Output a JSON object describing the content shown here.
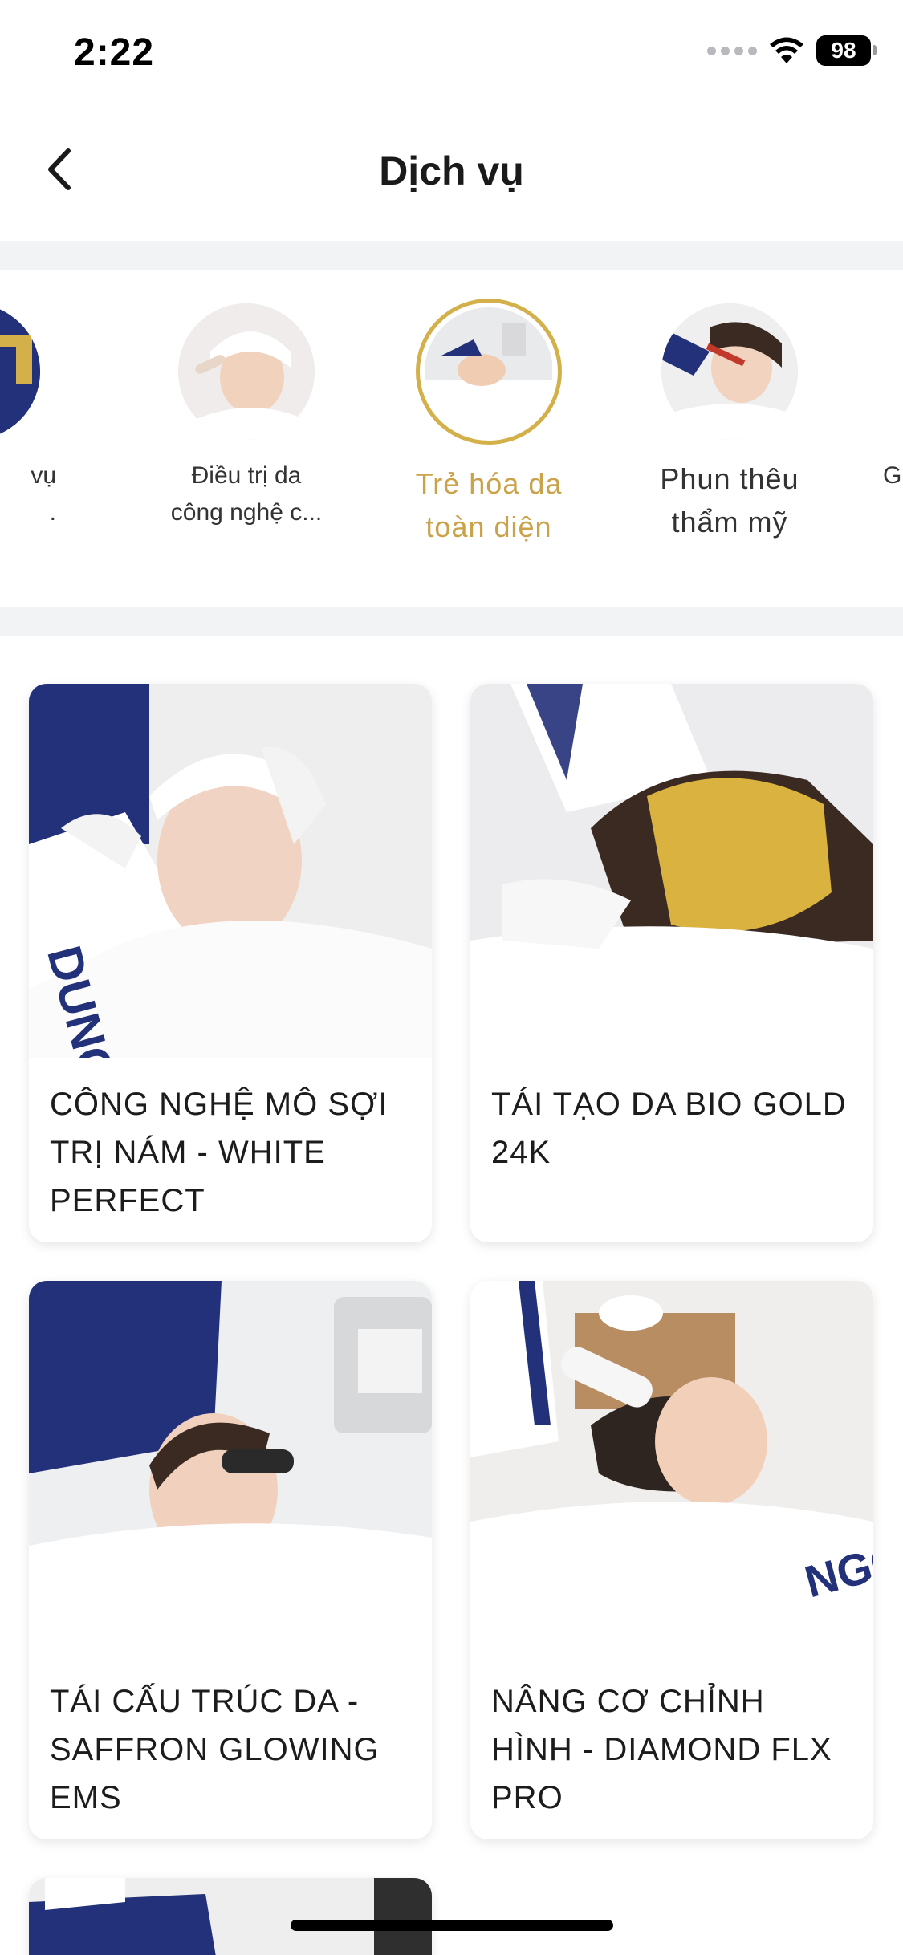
{
  "status": {
    "time": "2:22",
    "battery": "98"
  },
  "header": {
    "title": "Dịch vụ"
  },
  "categories": [
    {
      "label_line1": "vụ",
      "label_line2": "."
    },
    {
      "label_line1": "Điều trị da",
      "label_line2": "công nghệ c..."
    },
    {
      "label_line1": "Trẻ hóa da",
      "label_line2": "toàn diện",
      "active": true
    },
    {
      "label_line1": "Phun thêu",
      "label_line2": "thẩm mỹ"
    },
    {
      "label_line1": "G",
      "label_line2": ""
    }
  ],
  "services": [
    {
      "title": "CÔNG NGHỆ MÔ SỢI TRỊ NÁM - WHITE PERFECT"
    },
    {
      "title": "TÁI TẠO DA BIO GOLD 24K"
    },
    {
      "title": "TÁI CẤU TRÚC DA - SAFFRON GLOWING EMS"
    },
    {
      "title": "NÂNG CƠ CHỈNH HÌNH - DIAMOND FLX PRO"
    }
  ],
  "colors": {
    "accent": "#c9a24a",
    "accent_border": "#d4b04a",
    "brand_navy": "#23307a"
  }
}
